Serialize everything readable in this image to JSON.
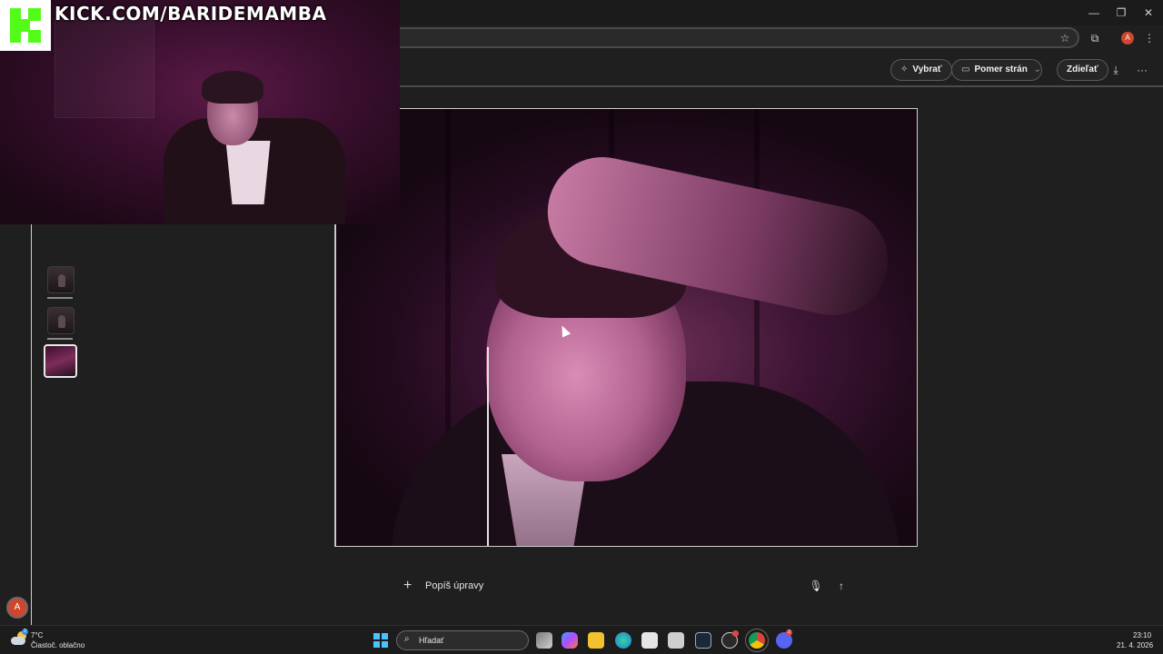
{
  "browser": {
    "minimize_icon": "—",
    "restore_icon": "❐",
    "close_icon": "✕",
    "star_icon": "☆",
    "extensions_icon": "⧉",
    "profile_initial": "A",
    "menu_icon": "⋮"
  },
  "toolbar": {
    "select_label": "Vybrať",
    "aspect_label": "Pomer strán",
    "share_label": "Zdieľať",
    "download_icon": "⤓",
    "more_icon": "···"
  },
  "prompt": {
    "placeholder": "Popíš úpravy",
    "plus_icon": "+",
    "mic_icon": "🎙",
    "send_icon": "↑"
  },
  "sidebar": {
    "avatar_initial": "A"
  },
  "stream_overlay": {
    "url": "KICK.COM/BARIDEMAMBA"
  },
  "taskbar": {
    "temperature": "7°C",
    "weather_desc": "Čiastoč. oblačno",
    "search_label": "Hľadať",
    "search_icon": "⌕",
    "time": "23:10",
    "date": "21. 4. 2026",
    "weather_badge": "2",
    "discord_badge": "2"
  },
  "colors": {
    "kick_green": "#53fc18",
    "profile_red": "#d0452e",
    "windows_blue": "#4cc2ff"
  }
}
